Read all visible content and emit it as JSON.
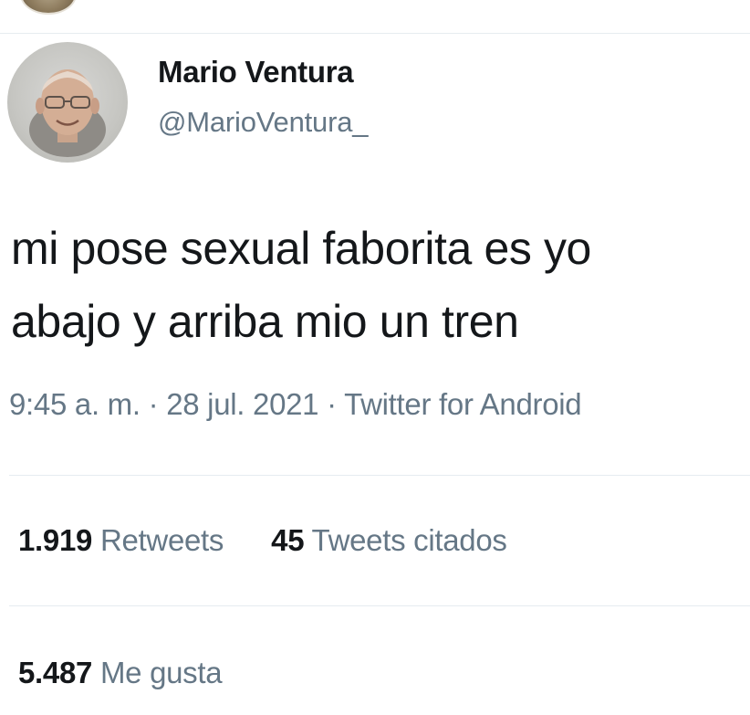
{
  "author": {
    "name": "Mario Ventura",
    "handle": "@MarioVentura_"
  },
  "tweet": {
    "lines": [
      "mi pose sexual faborita es yo",
      "abajo y arriba mio un tren"
    ]
  },
  "meta": {
    "time": "9:45 a. m.",
    "separator": " · ",
    "date": "28 jul. 2021",
    "source": "Twitter for Android"
  },
  "stats": {
    "retweets": {
      "count": "1.919",
      "label": "Retweets"
    },
    "quotes": {
      "count": "45",
      "label": "Tweets citados"
    },
    "likes": {
      "count": "5.487",
      "label": "Me gusta"
    }
  },
  "colors": {
    "text_primary": "#14171a",
    "text_secondary": "#657786",
    "divider": "#e6ecf0"
  },
  "icons": {
    "top_avatar": "profile-photo",
    "author_avatar": "profile-photo"
  }
}
